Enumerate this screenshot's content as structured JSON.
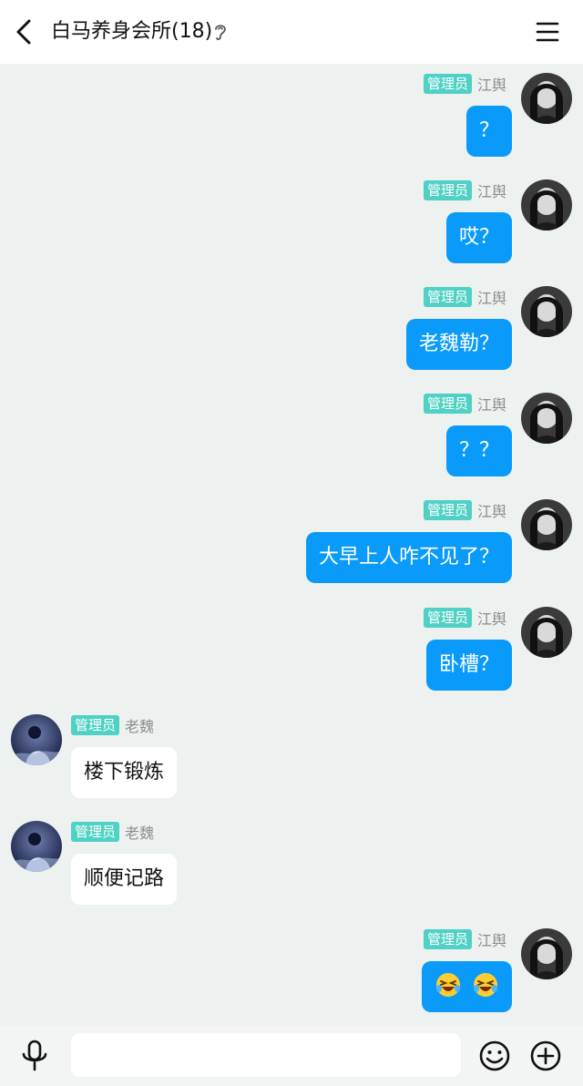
{
  "header": {
    "title": "白马养身会所(18)",
    "back_icon": "chevron-left-icon",
    "ear_icon": "ear-icon",
    "menu_icon": "menu-icon"
  },
  "colors": {
    "background": "#edf1ef",
    "bubble_self": "#0a9bfa",
    "bubble_other": "#ffffff",
    "admin_badge": "#4fd1c5"
  },
  "messages": [
    {
      "side": "right",
      "badge": "管理员",
      "sender": "江舆",
      "text": "？"
    },
    {
      "side": "right",
      "badge": "管理员",
      "sender": "江舆",
      "text": "哎？"
    },
    {
      "side": "right",
      "badge": "管理员",
      "sender": "江舆",
      "text": "老魏勒？"
    },
    {
      "side": "right",
      "badge": "管理员",
      "sender": "江舆",
      "text": "？？"
    },
    {
      "side": "right",
      "badge": "管理员",
      "sender": "江舆",
      "text": "大早上人咋不见了？"
    },
    {
      "side": "right",
      "badge": "管理员",
      "sender": "江舆",
      "text": "卧槽？"
    },
    {
      "side": "left",
      "badge": "管理员",
      "sender": "老魏",
      "text": "楼下锻炼"
    },
    {
      "side": "left",
      "badge": "管理员",
      "sender": "老魏",
      "text": "顺便记路"
    },
    {
      "side": "right",
      "badge": "管理员",
      "sender": "江舆",
      "emoji": [
        "laughing-crying-emoji",
        "laughing-crying-emoji"
      ]
    }
  ],
  "input_bar": {
    "mic_icon": "microphone-icon",
    "input_value": "",
    "input_placeholder": "",
    "emoji_icon": "smiley-icon",
    "plus_icon": "plus-circle-icon"
  }
}
